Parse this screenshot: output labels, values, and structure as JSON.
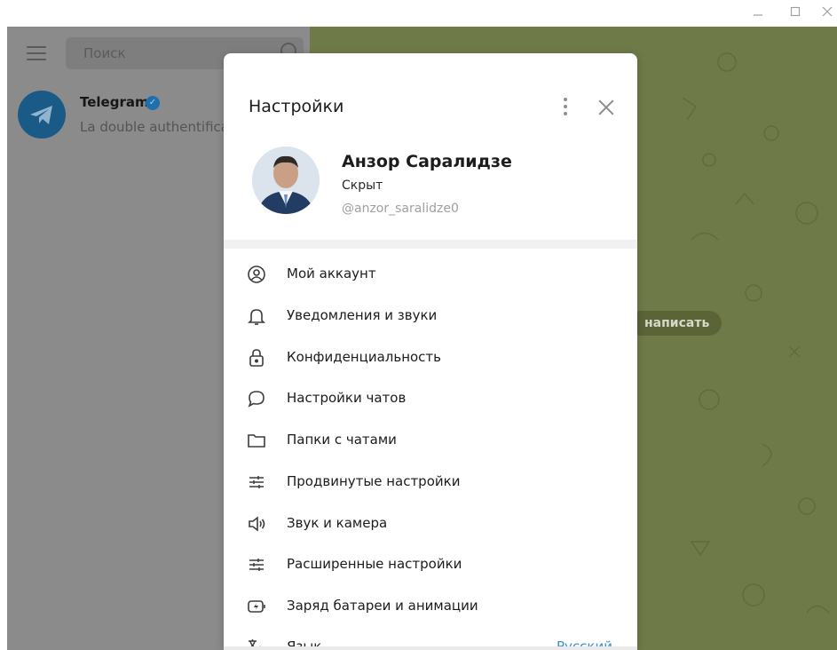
{
  "window": {
    "minimize_icon": "minimize-icon",
    "maximize_icon": "maximize-icon",
    "close_icon": "close-icon"
  },
  "sidebar": {
    "search_placeholder": "Поиск",
    "chats": [
      {
        "name": "Telegram",
        "verified": true,
        "preview": "La double authentification"
      }
    ]
  },
  "chat_area": {
    "hint_text": "написать"
  },
  "settings": {
    "title": "Настройки",
    "profile": {
      "name": "Анзор Саралидзе",
      "status": "Скрыт",
      "username": "@anzor_saralidze0"
    },
    "menu": [
      {
        "label": "Мой аккаунт",
        "icon": "account-icon"
      },
      {
        "label": "Уведомления и звуки",
        "icon": "bell-icon"
      },
      {
        "label": "Конфиденциальность",
        "icon": "lock-icon"
      },
      {
        "label": "Настройки чатов",
        "icon": "chat-bubble-icon"
      },
      {
        "label": "Папки с чатами",
        "icon": "folder-icon"
      },
      {
        "label": "Продвинутые настройки",
        "icon": "sliders-icon"
      },
      {
        "label": "Звук и камера",
        "icon": "speaker-icon"
      },
      {
        "label": "Расширенные настройки",
        "icon": "sliders-icon"
      },
      {
        "label": "Заряд батареи и анимации",
        "icon": "battery-icon"
      },
      {
        "label": "Язык",
        "icon": "translate-icon",
        "value": "Русский"
      }
    ]
  },
  "colors": {
    "accent": "#3a8fd0",
    "sidebar_dim": "#8b8b8b",
    "chat_bg_dim": "#6f7a49"
  }
}
